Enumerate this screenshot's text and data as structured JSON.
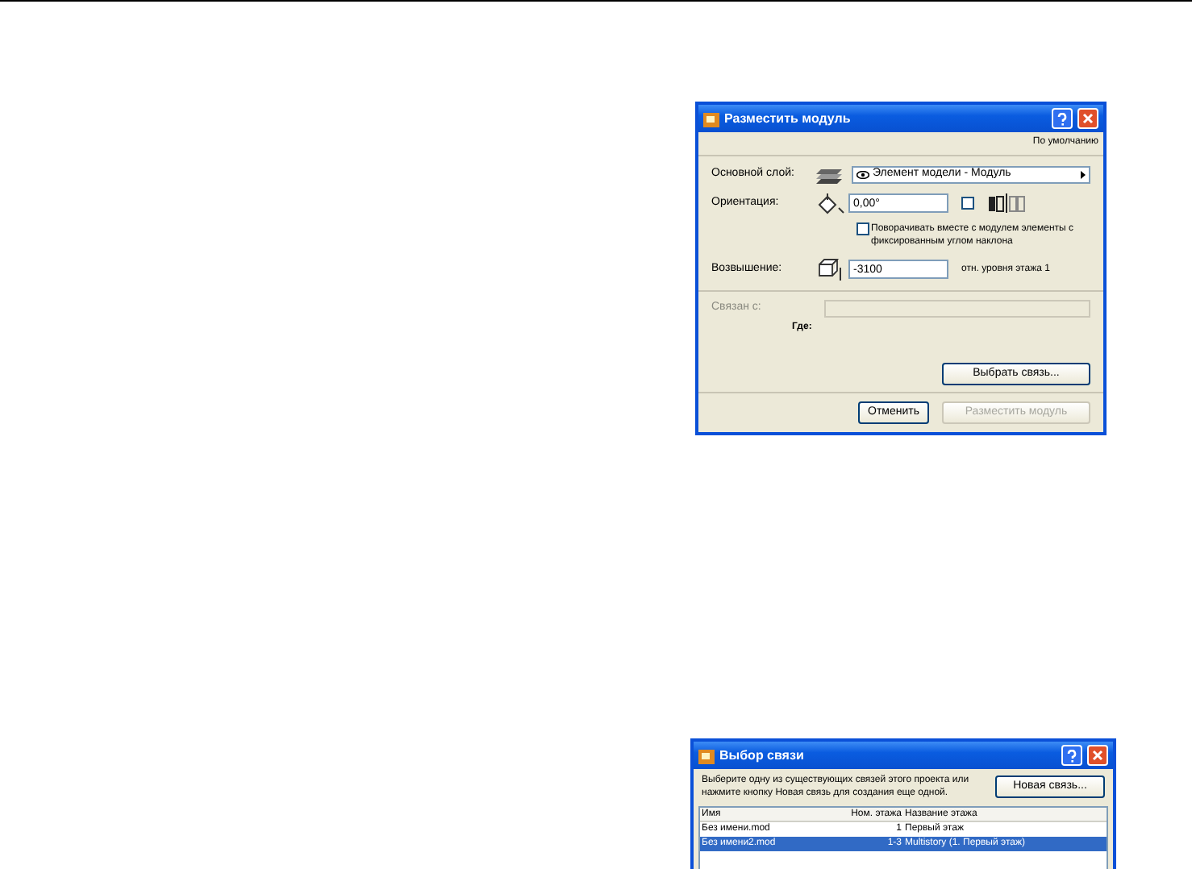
{
  "dialogs": [
    {
      "kind": "place",
      "title": "Разместить модуль",
      "defaults": "По умолчанию",
      "layer": {
        "label": "Основной слой:",
        "value": "Элемент модели - Модуль"
      },
      "orientation": {
        "label": "Ориентация:",
        "value": "0,00°",
        "mirror_checked": false
      },
      "rotate": {
        "label": "Поворачивать вместе с модулем элементы с фиксированным углом наклона",
        "checked": false
      },
      "elevation": {
        "label": "Возвышение:",
        "value": "-3100",
        "reference": "отн. уровня этажа 1"
      },
      "link": {
        "label": "Связан с:",
        "disabled": true,
        "where": "Где:"
      },
      "choose_button": "Выбрать связь...",
      "buttons": [
        {
          "label": "Отменить",
          "disabled": false
        },
        {
          "label": "Разместить модуль",
          "disabled": true
        }
      ]
    },
    {
      "kind": "select",
      "title": "Выбор связи",
      "instruction": "Выберите одну из существующих связей этого проекта или нажмите кнопку Новая связь для создания еще одной.",
      "new_button": "Новая связь...",
      "columns": [
        "Имя",
        "Ном. этажа",
        "Название этажа"
      ],
      "rows": [
        {
          "name": "Без имени.mod",
          "story_no": "1",
          "story_name": "Первый этаж",
          "selected": false
        },
        {
          "name": "Без имени2.mod",
          "story_no": "1-3",
          "story_name": "Multistory (1. Первый этаж)",
          "selected": true
        }
      ]
    }
  ]
}
